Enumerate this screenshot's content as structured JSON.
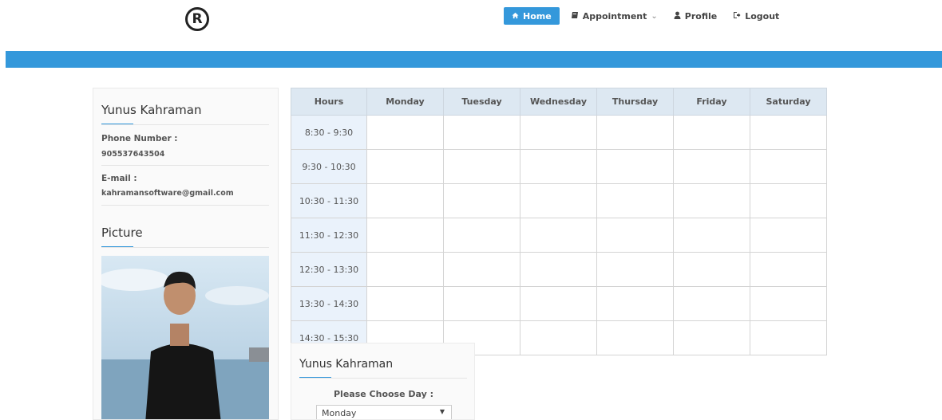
{
  "brand": {
    "logo_text": "R"
  },
  "nav": {
    "home": "Home",
    "appointment": "Appointment",
    "profile": "Profile",
    "logout": "Logout"
  },
  "sidebar": {
    "name": "Yunus Kahraman",
    "phone_label": "Phone Number :",
    "phone_value": "905537643504",
    "email_label": "E-mail :",
    "email_value": "kahramansoftware@gmail.com",
    "picture_title": "Picture"
  },
  "schedule": {
    "headers": [
      "Hours",
      "Monday",
      "Tuesday",
      "Wednesday",
      "Thursday",
      "Friday",
      "Saturday"
    ],
    "hours": [
      "8:30 - 9:30",
      "9:30 - 10:30",
      "10:30 - 11:30",
      "11:30 - 12:30",
      "12:30 - 13:30",
      "13:30 - 14:30",
      "14:30 - 15:30"
    ]
  },
  "daypicker": {
    "name": "Yunus Kahraman",
    "prompt": "Please Choose Day :",
    "selected": "Monday"
  },
  "colors": {
    "accent": "#3498db",
    "header_bg": "#dde8f2",
    "hour_bg": "#eaf2fb"
  }
}
